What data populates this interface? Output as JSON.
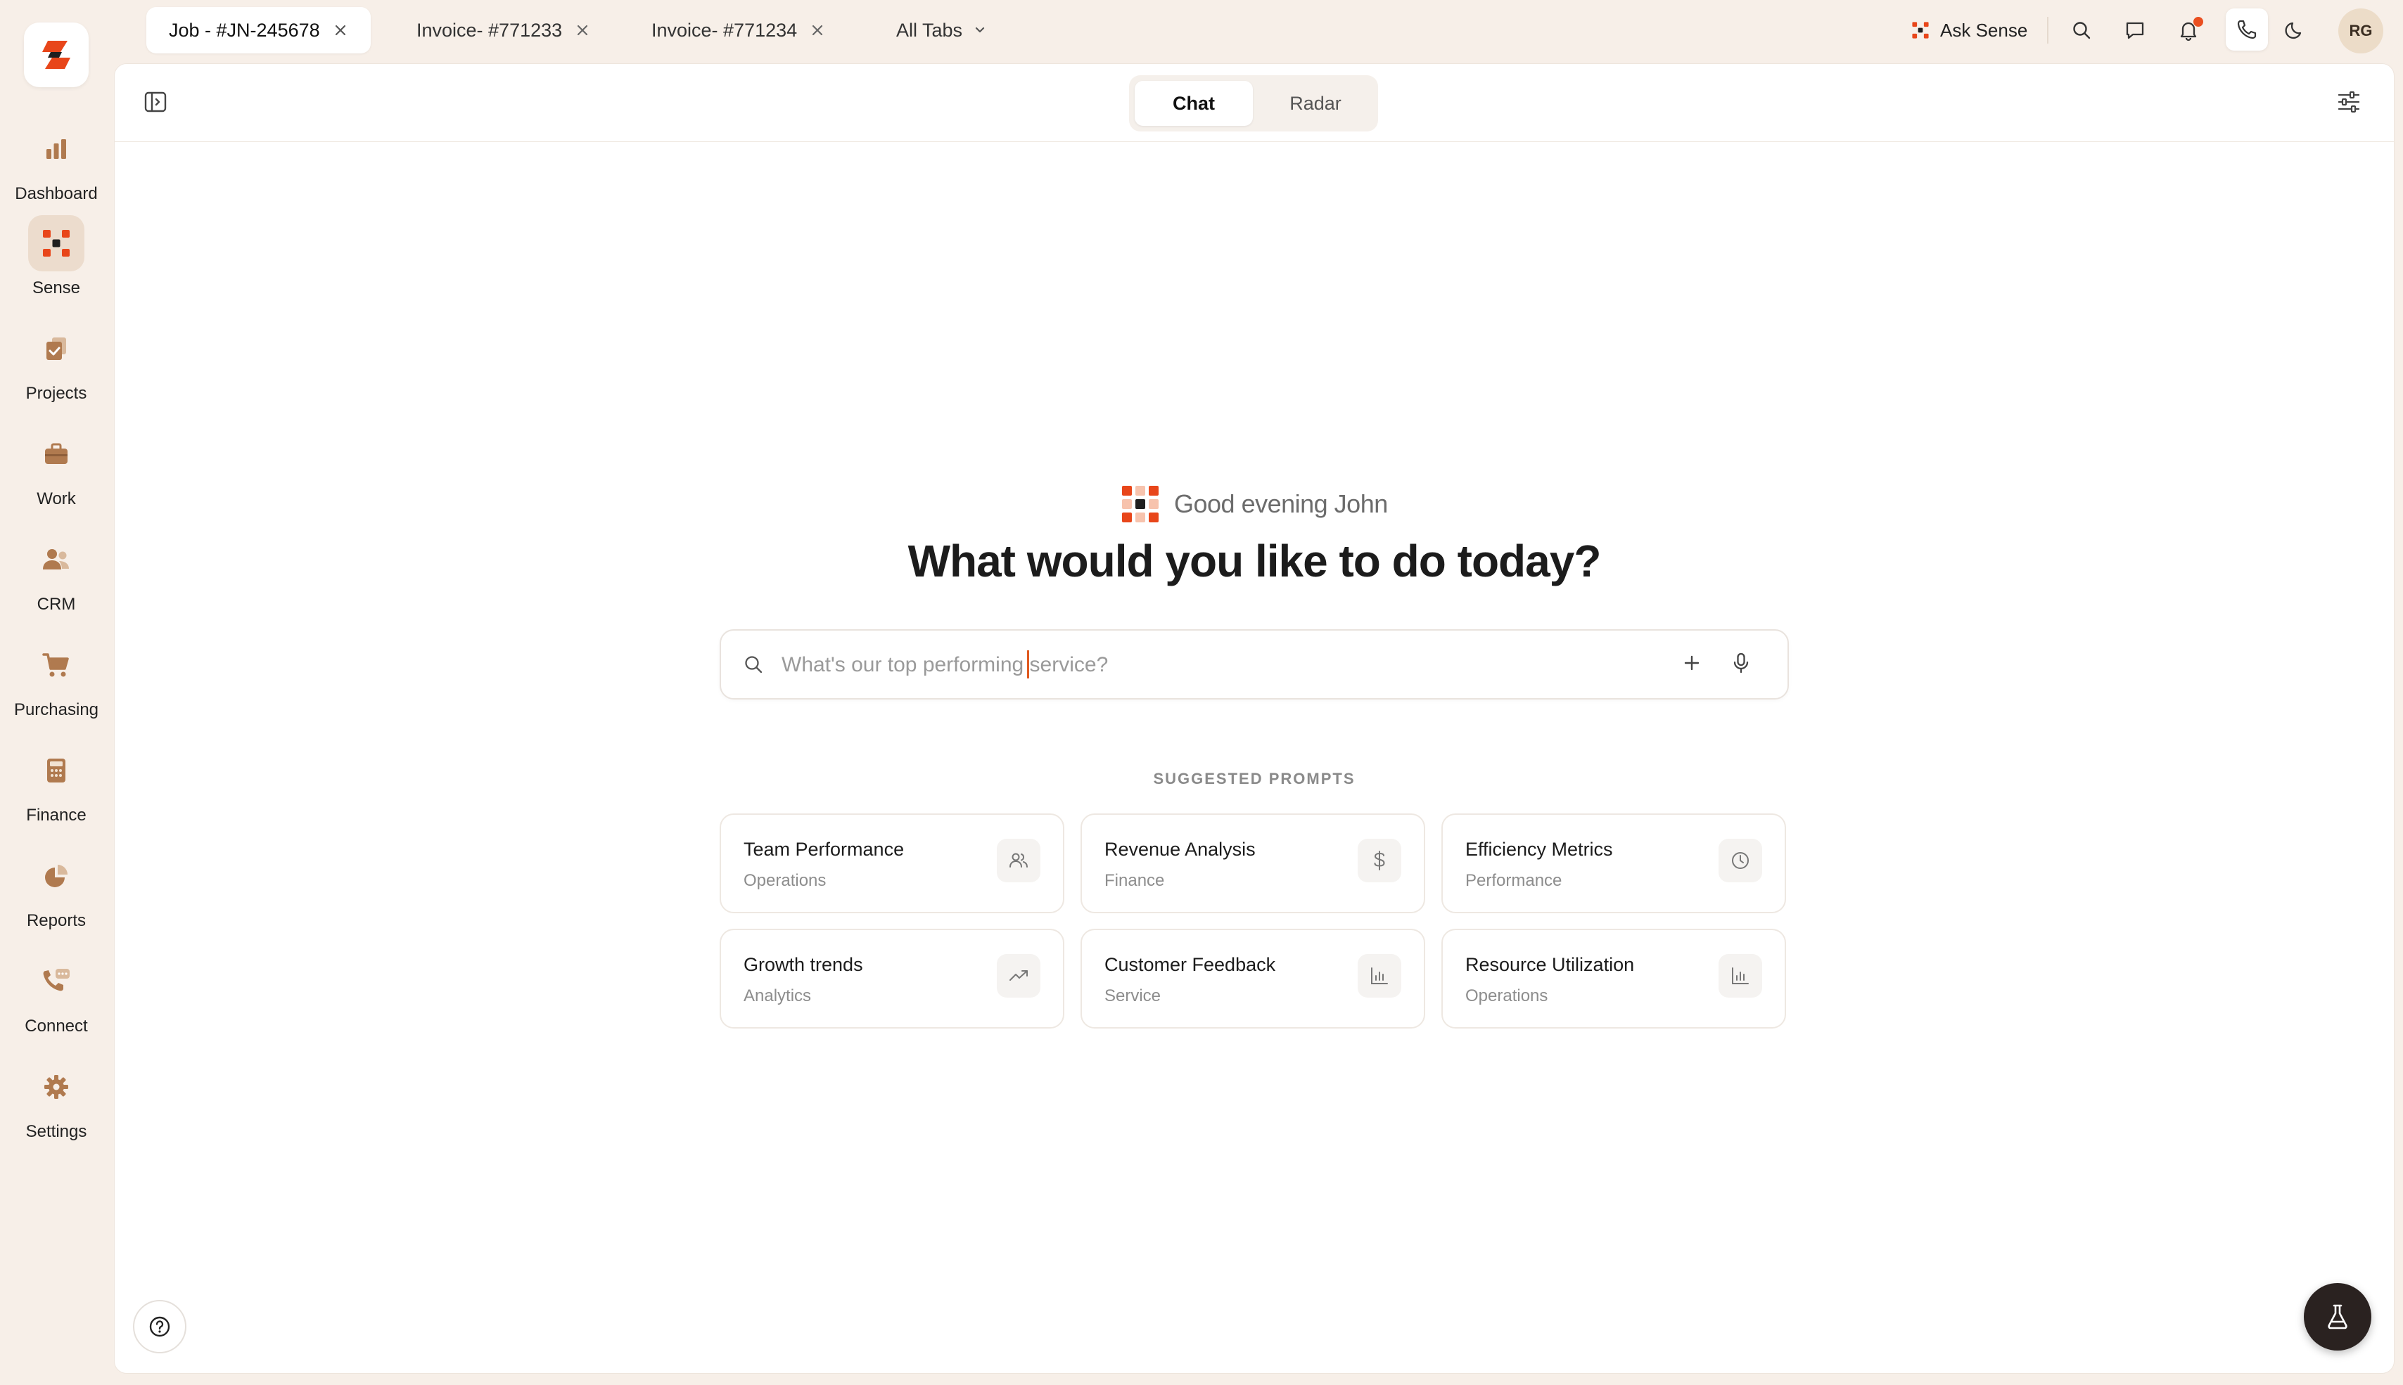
{
  "tabs": [
    {
      "label": "Job - #JN-245678",
      "active": true
    },
    {
      "label": "Invoice- #771233",
      "active": false
    },
    {
      "label": "Invoice- #771234",
      "active": false
    }
  ],
  "all_tabs_label": "All Tabs",
  "topbar": {
    "ask_sense_label": "Ask Sense",
    "avatar_initials": "RG"
  },
  "sidebar": {
    "items": [
      {
        "label": "Dashboard",
        "icon": "bar-chart-icon"
      },
      {
        "label": "Sense",
        "icon": "sense-icon",
        "active": true
      },
      {
        "label": "Projects",
        "icon": "clipboard-check-icon"
      },
      {
        "label": "Work",
        "icon": "briefcase-icon"
      },
      {
        "label": "CRM",
        "icon": "users-icon"
      },
      {
        "label": "Purchasing",
        "icon": "cart-icon"
      },
      {
        "label": "Finance",
        "icon": "calculator-icon"
      },
      {
        "label": "Reports",
        "icon": "pie-chart-icon"
      },
      {
        "label": "Connect",
        "icon": "phone-chat-icon"
      },
      {
        "label": "Settings",
        "icon": "gear-icon"
      }
    ]
  },
  "view_toggle": {
    "chat_label": "Chat",
    "radar_label": "Radar",
    "active": "Chat"
  },
  "greeting": "Good evening John",
  "headline": "What would you like to do today?",
  "search": {
    "placeholder": "What's our top performing service?"
  },
  "suggested_heading": "SUGGESTED PROMPTS",
  "prompts": [
    {
      "title": "Team Performance",
      "category": "Operations",
      "icon": "users-icon"
    },
    {
      "title": "Revenue Analysis",
      "category": "Finance",
      "icon": "dollar-icon"
    },
    {
      "title": "Efficiency Metrics",
      "category": "Performance",
      "icon": "clock-icon"
    },
    {
      "title": "Growth trends",
      "category": "Analytics",
      "icon": "trend-up-icon"
    },
    {
      "title": "Customer Feedback",
      "category": "Service",
      "icon": "bar-chart-icon"
    },
    {
      "title": "Resource Utilization",
      "category": "Operations",
      "icon": "bar-chart-icon"
    }
  ],
  "colors": {
    "brand_orange": "#e8461a",
    "sidebar_bg": "#f7efe8",
    "icon_brown": "#b07a4f"
  }
}
